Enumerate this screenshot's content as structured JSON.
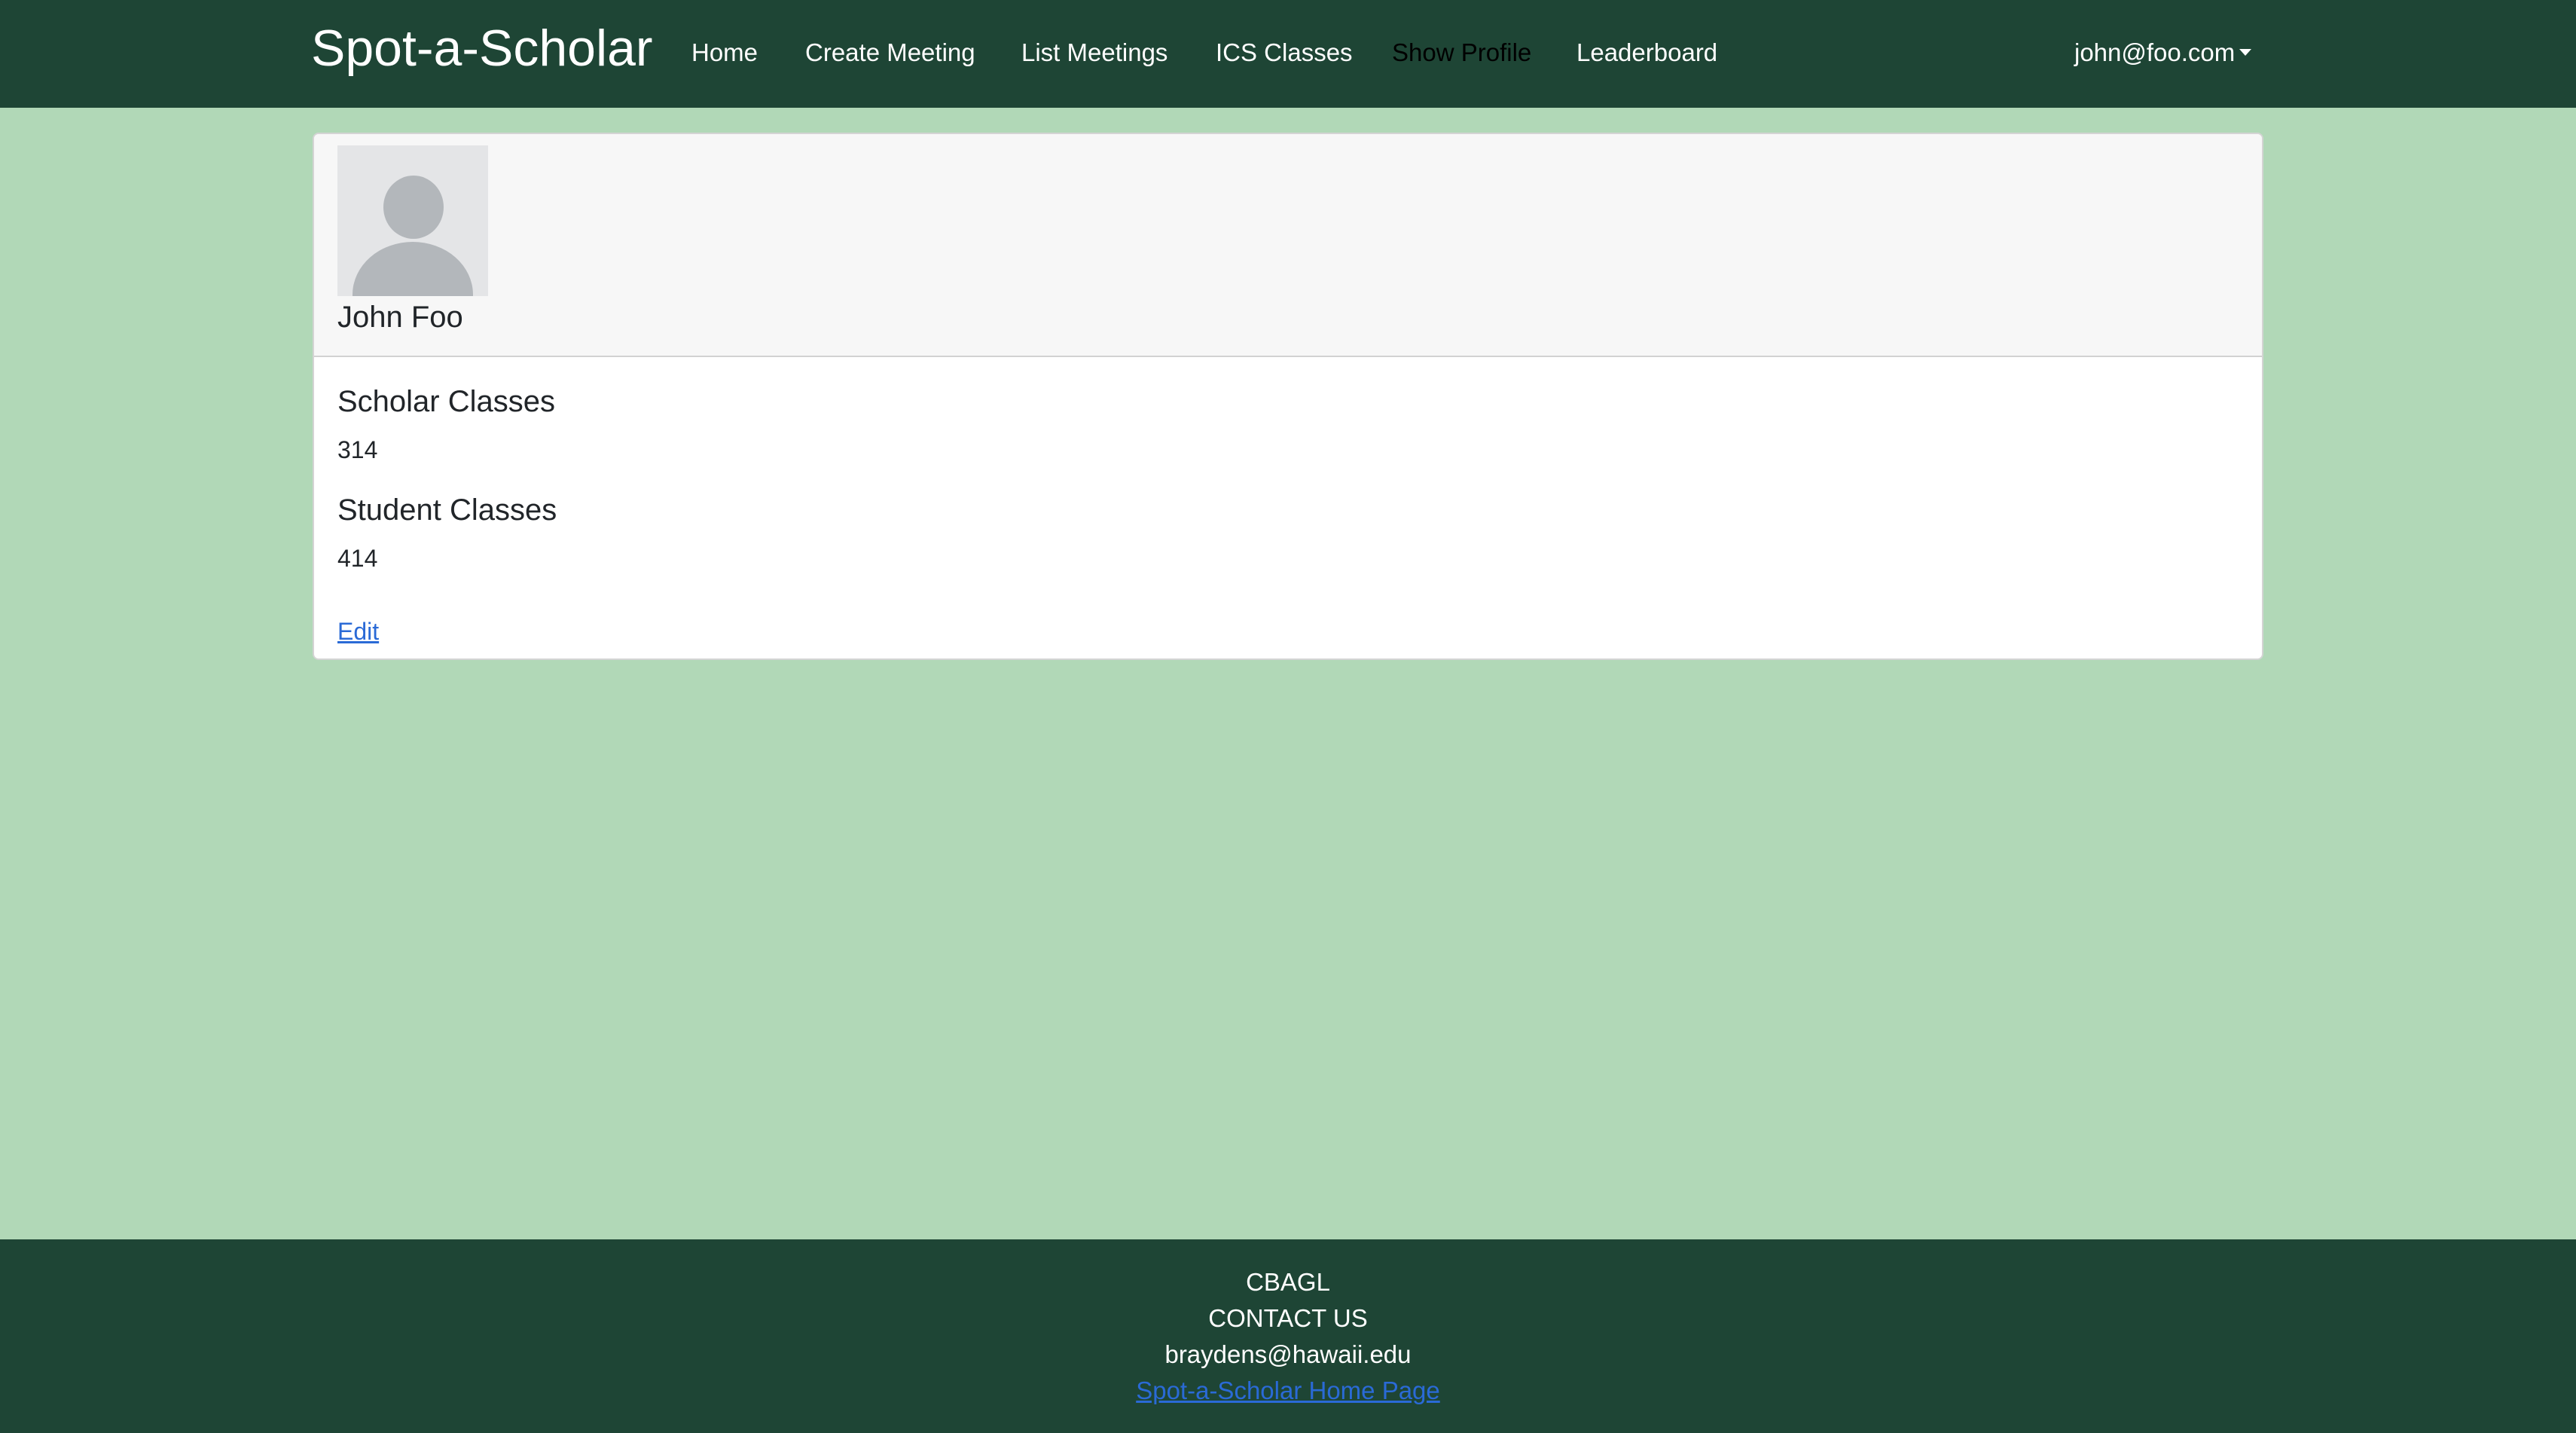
{
  "navbar": {
    "brand": "Spot-a-Scholar",
    "items": [
      {
        "label": "Home"
      },
      {
        "label": "Create Meeting"
      },
      {
        "label": "List Meetings"
      },
      {
        "label": "ICS Classes"
      },
      {
        "label": "Show Profile",
        "active": true
      },
      {
        "label": "Leaderboard"
      }
    ],
    "user_email": "john@foo.com",
    "user_menu_icon": "caret-down-icon"
  },
  "profile": {
    "avatar_icon": "user-avatar-placeholder-icon",
    "name": "John Foo",
    "scholar_classes_title": "Scholar Classes",
    "scholar_classes_value": "314",
    "student_classes_title": "Student Classes",
    "student_classes_value": "414",
    "edit_label": "Edit"
  },
  "footer": {
    "org": "CBAGL",
    "contact_label": "CONTACT US",
    "email": "braydens@hawaii.edu",
    "home_link_label": "Spot-a-Scholar Home Page"
  },
  "colors": {
    "navbar_bg": "#1e4535",
    "page_bg": "#b1d8b7",
    "link": "#2a6ad6",
    "card_header_bg": "#f7f7f7"
  }
}
